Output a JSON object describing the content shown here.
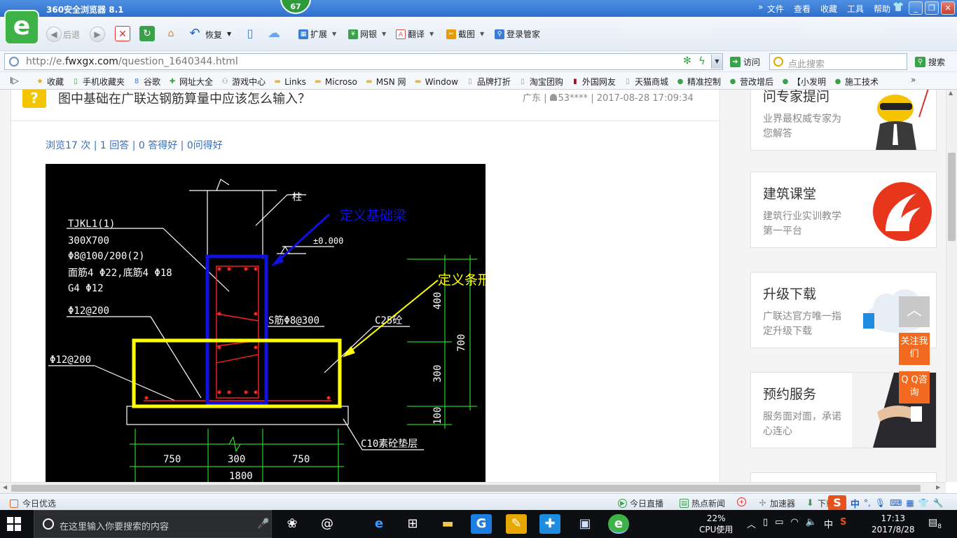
{
  "window": {
    "app_title": "360安全浏览器 8.1",
    "score_badge": "67",
    "menu": [
      "文件",
      "查看",
      "收藏",
      "工具",
      "帮助"
    ],
    "min_label": "_",
    "max_label": "❐",
    "close_label": "✕"
  },
  "toolbar": {
    "back_label": "后退",
    "restore_label": "恢复",
    "tools": [
      {
        "label": "扩展",
        "icon": "extension-icon",
        "color": "#3a7bd5"
      },
      {
        "label": "网银",
        "icon": "bank-icon",
        "color": "#3aa04a"
      },
      {
        "label": "翻译",
        "icon": "translate-icon",
        "color": "#d9534f"
      },
      {
        "label": "截图",
        "icon": "screenshot-icon",
        "color": "#e69b00"
      },
      {
        "label": "登录管家",
        "icon": "login-manager-icon",
        "color": "#3a7bd5"
      }
    ]
  },
  "address": {
    "url_prefix": "http://e.",
    "url_domain": "fwxgx.com",
    "url_path": "/question_1640344.html",
    "visit_label": "访问",
    "search_placeholder": "点此搜索",
    "search_label": "搜索"
  },
  "bookmarks": [
    {
      "label": "收藏",
      "icon": "star-icon",
      "color": "#e6a700"
    },
    {
      "label": "手机收藏夹",
      "icon": "phone-icon",
      "color": "#3aa04a"
    },
    {
      "label": "谷歌",
      "icon": "google-icon",
      "color": "#3a7bd5"
    },
    {
      "label": "网址大全",
      "icon": "plus-icon",
      "color": "#3aa04a"
    },
    {
      "label": "游戏中心",
      "icon": "gamepad-icon",
      "color": "#777"
    },
    {
      "label": "Links",
      "icon": "folder-icon",
      "color": "#e6b84a"
    },
    {
      "label": "Microso",
      "icon": "folder-icon",
      "color": "#e6b84a"
    },
    {
      "label": "MSN 网",
      "icon": "folder-icon",
      "color": "#e6b84a"
    },
    {
      "label": "Window",
      "icon": "folder-icon",
      "color": "#e6b84a"
    },
    {
      "label": "品牌打折",
      "icon": "page-icon",
      "color": "#999"
    },
    {
      "label": "淘宝团购",
      "icon": "page-icon",
      "color": "#999"
    },
    {
      "label": "外国网友",
      "icon": "flag-icon",
      "color": "#b8001c"
    },
    {
      "label": "天猫商城",
      "icon": "page-icon",
      "color": "#999"
    },
    {
      "label": "精准控制",
      "icon": "wechat-icon",
      "color": "#3aa04a"
    },
    {
      "label": "营改增后",
      "icon": "wechat-icon",
      "color": "#3aa04a"
    },
    {
      "label": "【小发明",
      "icon": "wechat-icon",
      "color": "#3aa04a"
    },
    {
      "label": "施工技术",
      "icon": "wechat-icon",
      "color": "#3aa04a"
    }
  ],
  "page": {
    "question_icon": "?",
    "question_title": "图中基础在广联达钢筋算量中应该怎么输入？",
    "meta_region": "广东 |",
    "meta_user": "53****",
    "meta_time": "| 2017-08-28 17:09:34",
    "stats": "浏览17 次 | 1 回答 | 0 答得好 | 0问得好"
  },
  "drawing": {
    "labels": {
      "column": "柱",
      "beam_id": "TJKL1(1)",
      "beam_size": "300X700",
      "stirrup": "Φ8@100/200(2)",
      "top_bottom_bars": "面筋4 Φ22,底筋4 Φ18",
      "side_bars": "G4 Φ12",
      "dist_bar_1": "Φ12@200",
      "dist_bar_2": "Φ12@200",
      "level": "±0.000",
      "tie": "S筋Φ8@300",
      "concrete": "C25砼",
      "cushion": "C10素砼垫层",
      "dim_750a": "750",
      "dim_300": "300",
      "dim_750b": "750",
      "dim_1800": "1800",
      "dim_400": "400",
      "dim_700": "700",
      "dim_300v": "300",
      "dim_100": "100"
    },
    "annotations": {
      "foundation_beam": "定义基础梁",
      "strip_foundation": "定义条形基础"
    },
    "colors": {
      "beam_box": "#1010e0",
      "footing_box": "#ffff00",
      "rebar": "#ff2020",
      "lines": "#ffffff",
      "dims": "#2cff2c"
    }
  },
  "sidebar": [
    {
      "title": "问专家提问",
      "desc": "业界最权威专家为您解答",
      "art": "mascot-icon"
    },
    {
      "title": "建筑课堂",
      "desc": "建筑行业实训教学第一平台",
      "art": "classroom-logo-icon"
    },
    {
      "title": "升级下载",
      "desc": "广联达官方唯一指定升级下载",
      "art": "cloud-download-icon"
    },
    {
      "title": "预约服务",
      "desc": "服务面对面，承诺心连心",
      "art": "handshake-icon"
    }
  ],
  "float": {
    "top_label": "︿",
    "follow_label": "关注我们",
    "qq_label": "Q Q咨询"
  },
  "statusbar": {
    "left": "今日优选",
    "items": [
      "今日直播",
      "热点新闻",
      "加速器",
      "下载"
    ],
    "ime_zh": "中"
  },
  "taskbar": {
    "search_placeholder": "在这里输入你要搜索的内容",
    "cpu_percent": "22%",
    "cpu_label": "CPU使用",
    "time": "17:13",
    "date": "2017/8/28",
    "tray_lang": "中",
    "notif_count": "8"
  }
}
